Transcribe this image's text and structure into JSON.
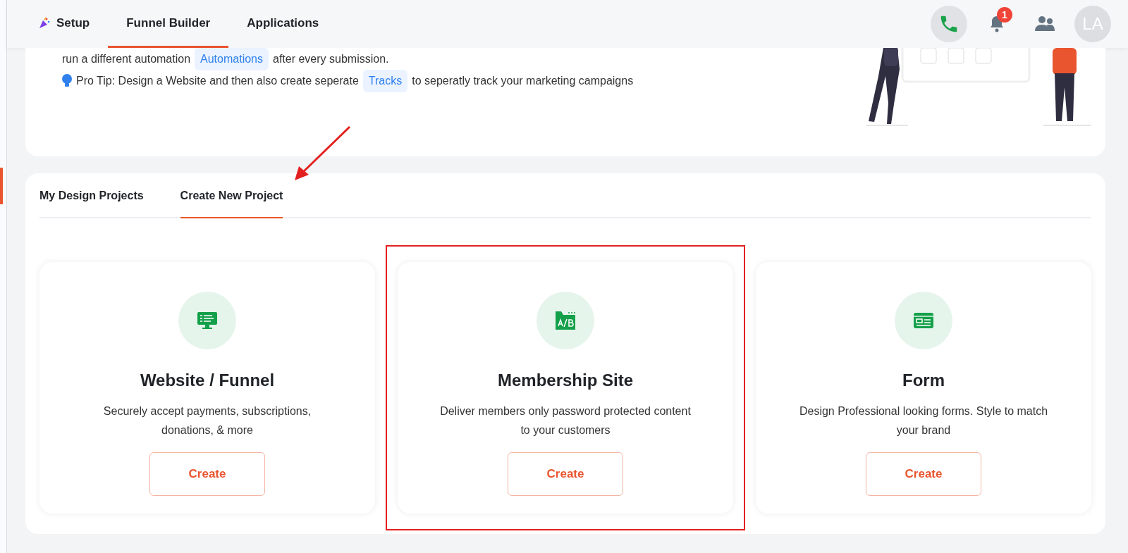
{
  "nav": {
    "items": [
      {
        "label": "Setup",
        "kind": "icon-link",
        "selected": false
      },
      {
        "label": "Funnel Builder",
        "kind": "link",
        "selected": true
      },
      {
        "label": "Applications",
        "kind": "link",
        "selected": false
      }
    ]
  },
  "header_actions": {
    "notification_count": "1",
    "avatar_initials": "LA"
  },
  "intro": {
    "lines": [
      {
        "kind": "plain",
        "parts": [
          {
            "kind": "text",
            "text": "run a different automation"
          },
          {
            "kind": "chip",
            "text": "Automations"
          },
          {
            "kind": "text",
            "text": "after every submission."
          }
        ]
      },
      {
        "kind": "tip",
        "parts": [
          {
            "kind": "text",
            "text": "Pro Tip: Design a Website and then also create seperate"
          },
          {
            "kind": "chip",
            "text": "Tracks"
          },
          {
            "kind": "text",
            "text": "to seperatly track your marketing campaigns"
          }
        ]
      }
    ]
  },
  "tabs": [
    {
      "label": "My Design Projects",
      "selected": false
    },
    {
      "label": "Create New Project",
      "selected": true
    }
  ],
  "cards": [
    {
      "kind": "monitor",
      "title": "Website / Funnel",
      "description": "Securely accept payments, subscriptions, donations, & more",
      "button": "Create",
      "annotated": false
    },
    {
      "kind": "ab",
      "title": "Membership Site",
      "description": "Deliver members only password protected content to your customers",
      "button": "Create",
      "annotated": true
    },
    {
      "kind": "form",
      "title": "Form",
      "description": "Design Professional looking forms. Style to match your brand",
      "button": "Create",
      "annotated": false
    }
  ]
}
